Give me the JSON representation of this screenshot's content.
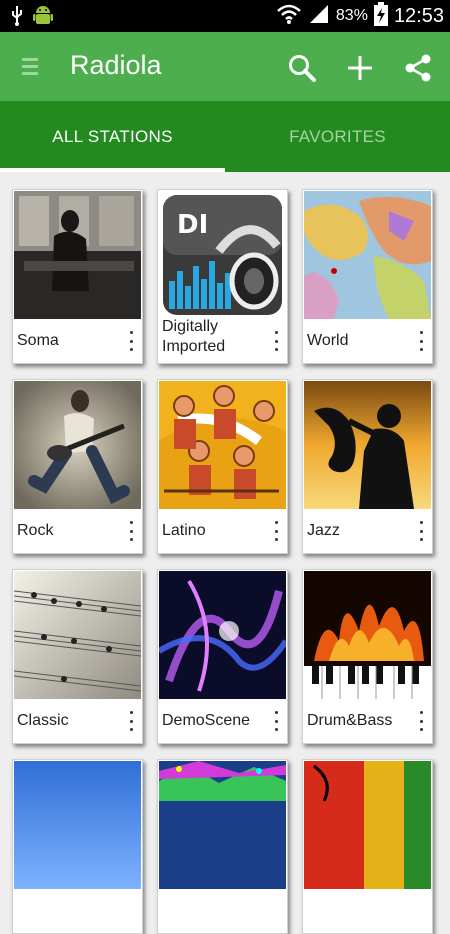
{
  "status": {
    "battery": "83%",
    "time": "12:53",
    "icons": [
      "usb-icon",
      "android-icon",
      "wifi-icon",
      "signal-icon",
      "battery-charging-icon"
    ]
  },
  "appbar": {
    "title": "Radiola",
    "color": "#4cae4c",
    "actions": [
      "search-icon",
      "add-icon",
      "share-icon"
    ]
  },
  "tabs": {
    "items": [
      {
        "label": "ALL STATIONS",
        "active": true
      },
      {
        "label": "FAVORITES",
        "active": false
      }
    ],
    "color": "#228a1f"
  },
  "stations": [
    {
      "name": "Soma"
    },
    {
      "name": "Digitally Imported"
    },
    {
      "name": "World"
    },
    {
      "name": "Rock"
    },
    {
      "name": "Latino"
    },
    {
      "name": "Jazz"
    },
    {
      "name": "Classic"
    },
    {
      "name": "DemoScene"
    },
    {
      "name": "Drum&Bass"
    },
    {
      "name": ""
    },
    {
      "name": ""
    },
    {
      "name": ""
    }
  ]
}
